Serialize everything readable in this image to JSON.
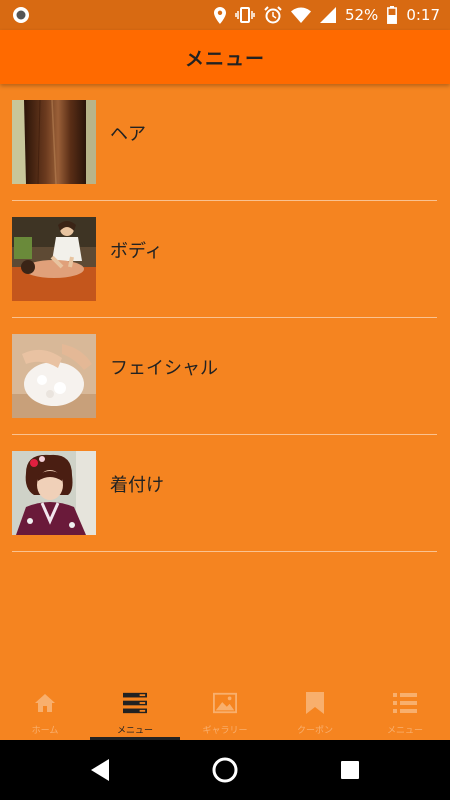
{
  "status_bar": {
    "battery": "52%",
    "time": "0:17",
    "icons": [
      "app-indicator-icon",
      "location-icon",
      "vibrate-icon",
      "alarm-icon",
      "wifi-icon",
      "signal-icon",
      "battery-icon"
    ]
  },
  "header": {
    "title": "メニュー"
  },
  "menu": {
    "items": [
      {
        "label": "ヘア",
        "image": "hair-photo"
      },
      {
        "label": "ボディ",
        "image": "massage-photo"
      },
      {
        "label": "フェイシャル",
        "image": "facial-photo"
      },
      {
        "label": "着付け",
        "image": "kimono-photo"
      }
    ]
  },
  "bottom_nav": {
    "items": [
      {
        "label": "ホーム",
        "icon": "home-icon",
        "active": false
      },
      {
        "label": "メニュー",
        "icon": "menu-list-icon",
        "active": true
      },
      {
        "label": "ギャラリー",
        "icon": "gallery-icon",
        "active": false
      },
      {
        "label": "クーポン",
        "icon": "bookmark-icon",
        "active": false
      },
      {
        "label": "メニュー",
        "icon": "list-icon",
        "active": false
      }
    ]
  },
  "colors": {
    "background": "#f58420",
    "header": "#ff6a00",
    "status_bar": "#d86a12",
    "text": "#222222"
  }
}
